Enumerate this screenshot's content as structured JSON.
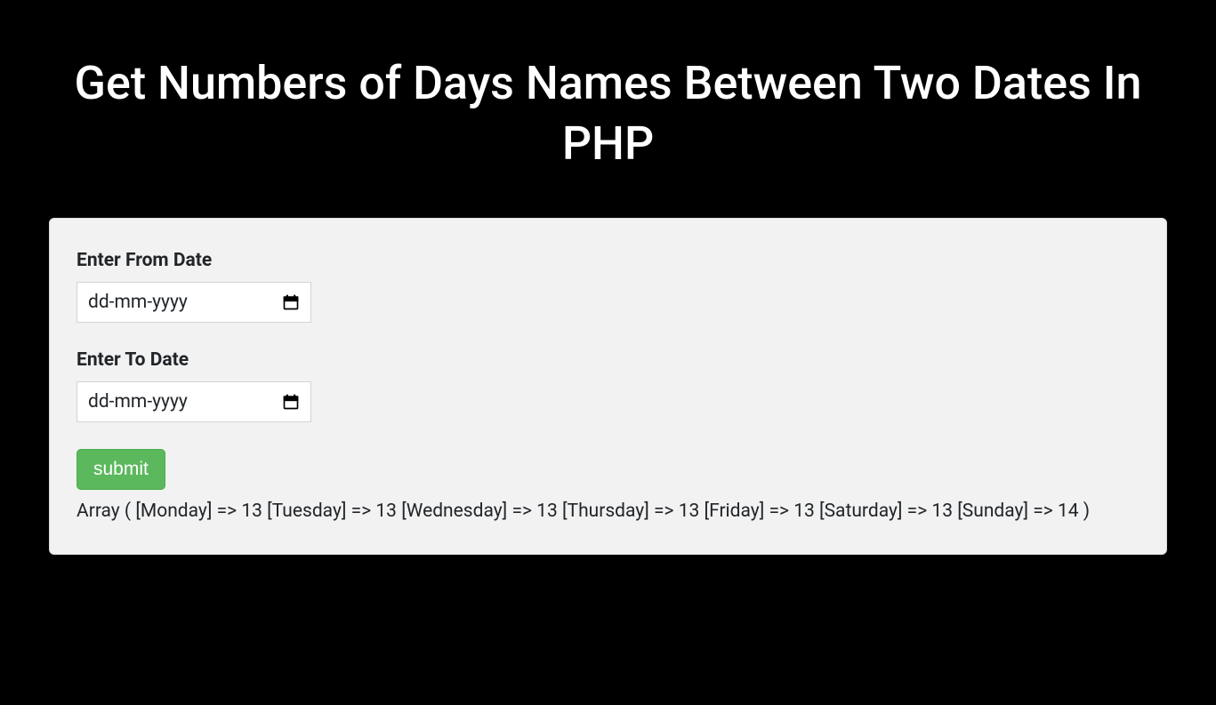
{
  "header": {
    "title": "Get Numbers of Days Names Between Two Dates In PHP"
  },
  "form": {
    "from_date": {
      "label": "Enter From Date",
      "placeholder": "dd-mm-yyyy"
    },
    "to_date": {
      "label": "Enter To Date",
      "placeholder": "dd-mm-yyyy"
    },
    "submit_label": "submit"
  },
  "output": {
    "result_text": "Array ( [Monday] => 13 [Tuesday] => 13 [Wednesday] => 13 [Thursday] => 13 [Friday] => 13 [Saturday] => 13 [Sunday] => 14 )"
  }
}
